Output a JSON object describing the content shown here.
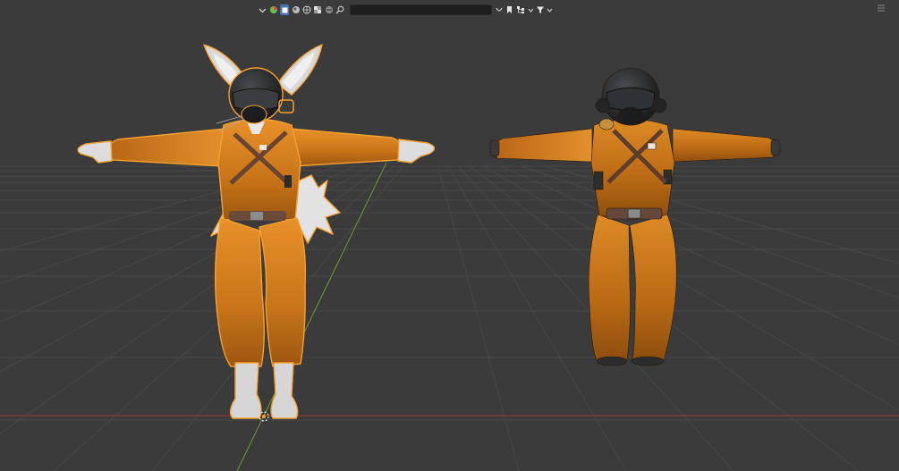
{
  "viewport": {
    "background": "#3b3b3b",
    "grid_color": "#474747",
    "x_axis_color": "#a0353a",
    "y_axis_color": "#6b9a34",
    "selection_outline": "#f5a030"
  },
  "header": {
    "search_placeholder": "",
    "icons": [
      "chevron-down-icon",
      "scene-icon",
      "object-icon",
      "material-icon",
      "world-icon",
      "texture-icon",
      "search-icon",
      "clear-icon",
      "bookmark-icon",
      "hierarchy-icon",
      "chevron-down-icon",
      "filter-icon",
      "chevron-down-icon"
    ],
    "selected_icon": "object-icon",
    "accent": "#4772b3"
  },
  "objects": [
    {
      "name_icon": "fox-character",
      "selected": true,
      "suit_color": "#d9821c"
    },
    {
      "name_icon": "human-character",
      "selected": false,
      "suit_color": "#d07b1a"
    }
  ]
}
